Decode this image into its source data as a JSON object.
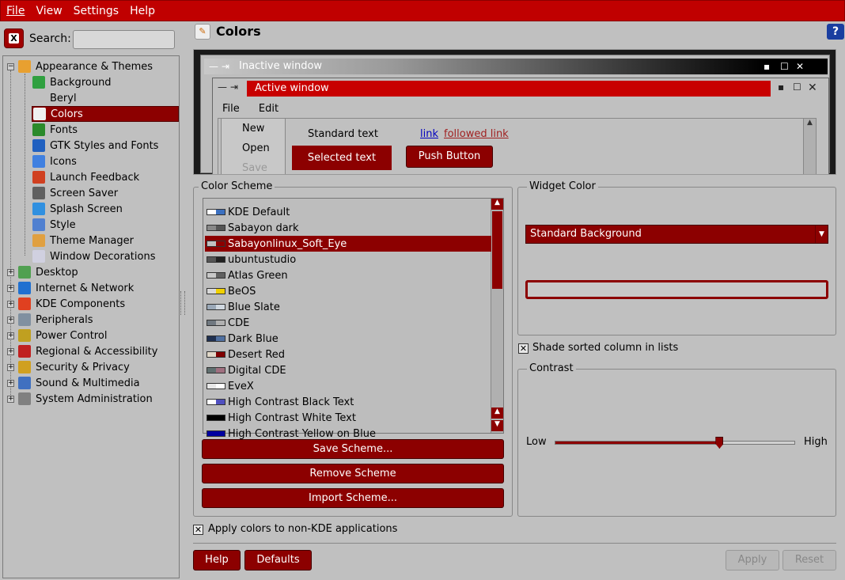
{
  "menu": {
    "file": "File",
    "view": "View",
    "settings": "Settings",
    "help": "Help"
  },
  "search": {
    "label": "Search:",
    "value": ""
  },
  "tree": [
    {
      "label": "Appearance & Themes",
      "level": 0,
      "exp": "−",
      "icon": "#e8a030"
    },
    {
      "label": "Background",
      "level": 1,
      "icon": "#30a040"
    },
    {
      "label": "Beryl",
      "level": 1,
      "icon": ""
    },
    {
      "label": "Colors",
      "level": 1,
      "icon": "#f0f0f0",
      "sel": true
    },
    {
      "label": "Fonts",
      "level": 1,
      "icon": "#2a8a2a"
    },
    {
      "label": "GTK Styles and Fonts",
      "level": 1,
      "icon": "#2060c0"
    },
    {
      "label": "Icons",
      "level": 1,
      "icon": "#4080e0"
    },
    {
      "label": "Launch Feedback",
      "level": 1,
      "icon": "#d04020"
    },
    {
      "label": "Screen Saver",
      "level": 1,
      "icon": "#606060"
    },
    {
      "label": "Splash Screen",
      "level": 1,
      "icon": "#3090e0"
    },
    {
      "label": "Style",
      "level": 1,
      "icon": "#5080d0"
    },
    {
      "label": "Theme Manager",
      "level": 1,
      "icon": "#e0a040"
    },
    {
      "label": "Window Decorations",
      "level": 1,
      "icon": "#d0d0e0"
    },
    {
      "label": "Desktop",
      "level": 0,
      "exp": "+",
      "icon": "#50a050"
    },
    {
      "label": "Internet & Network",
      "level": 0,
      "exp": "+",
      "icon": "#2070d0"
    },
    {
      "label": "KDE Components",
      "level": 0,
      "exp": "+",
      "icon": "#e04020"
    },
    {
      "label": "Peripherals",
      "level": 0,
      "exp": "+",
      "icon": "#8090a0"
    },
    {
      "label": "Power Control",
      "level": 0,
      "exp": "+",
      "icon": "#c0a020"
    },
    {
      "label": "Regional & Accessibility",
      "level": 0,
      "exp": "+",
      "icon": "#c02020"
    },
    {
      "label": "Security & Privacy",
      "level": 0,
      "exp": "+",
      "icon": "#d0a020"
    },
    {
      "label": "Sound & Multimedia",
      "level": 0,
      "exp": "+",
      "icon": "#4070c0"
    },
    {
      "label": "System Administration",
      "level": 0,
      "exp": "+",
      "icon": "#808080"
    }
  ],
  "page": {
    "title": "Colors"
  },
  "preview": {
    "inactive_title": "Inactive window",
    "active_title": "Active window",
    "menu_file": "File",
    "menu_edit": "Edit",
    "popup": [
      "New",
      "Open",
      "Save"
    ],
    "standard_text": "Standard text",
    "link": "link",
    "followed_link": "followed link",
    "selected_text": "Selected text",
    "push_button": "Push Button"
  },
  "scheme": {
    "title": "Color Scheme",
    "items": [
      {
        "name": "KDE Default",
        "c1": "#ffffff",
        "c2": "#3c70c0"
      },
      {
        "name": "Sabayon dark",
        "c1": "#888888",
        "c2": "#555555"
      },
      {
        "name": "Sabayonlinux_Soft_Eye",
        "c1": "#c0c0c0",
        "c2": "#8c0000",
        "sel": true
      },
      {
        "name": "ubuntustudio",
        "c1": "#555555",
        "c2": "#222222"
      },
      {
        "name": "Atlas Green",
        "c1": "#c8c8c8",
        "c2": "#606060"
      },
      {
        "name": "BeOS",
        "c1": "#d8d8d8",
        "c2": "#f0d000"
      },
      {
        "name": "Blue Slate",
        "c1": "#9aa8b8",
        "c2": "#d0d8e0"
      },
      {
        "name": "CDE",
        "c1": "#707880",
        "c2": "#b0b0b0"
      },
      {
        "name": "Dark Blue",
        "c1": "#203050",
        "c2": "#5070a0"
      },
      {
        "name": "Desert Red",
        "c1": "#e0d8c8",
        "c2": "#800000"
      },
      {
        "name": "Digital CDE",
        "c1": "#607070",
        "c2": "#a07080"
      },
      {
        "name": "EveX",
        "c1": "#e8e8e8",
        "c2": "#ffffff"
      },
      {
        "name": "High Contrast Black Text",
        "c1": "#ffffff",
        "c2": "#5050c0"
      },
      {
        "name": "High Contrast White Text",
        "c1": "#000000",
        "c2": "#000000"
      },
      {
        "name": "High Contrast Yellow on Blue",
        "c1": "#0000a0",
        "c2": "#0000a0"
      }
    ],
    "save": "Save Scheme...",
    "remove": "Remove Scheme",
    "import": "Import Scheme..."
  },
  "widget": {
    "title": "Widget Color",
    "selected": "Standard Background",
    "swatch_color": "#c8c8c8"
  },
  "shade": {
    "label": "Shade sorted column in lists",
    "checked": true
  },
  "contrast": {
    "title": "Contrast",
    "low": "Low",
    "high": "High",
    "value": 0.69
  },
  "apply_nonkde": {
    "label": "Apply colors to non-KDE applications",
    "checked": true
  },
  "footer": {
    "help": "Help",
    "defaults": "Defaults",
    "apply": "Apply",
    "reset": "Reset"
  }
}
